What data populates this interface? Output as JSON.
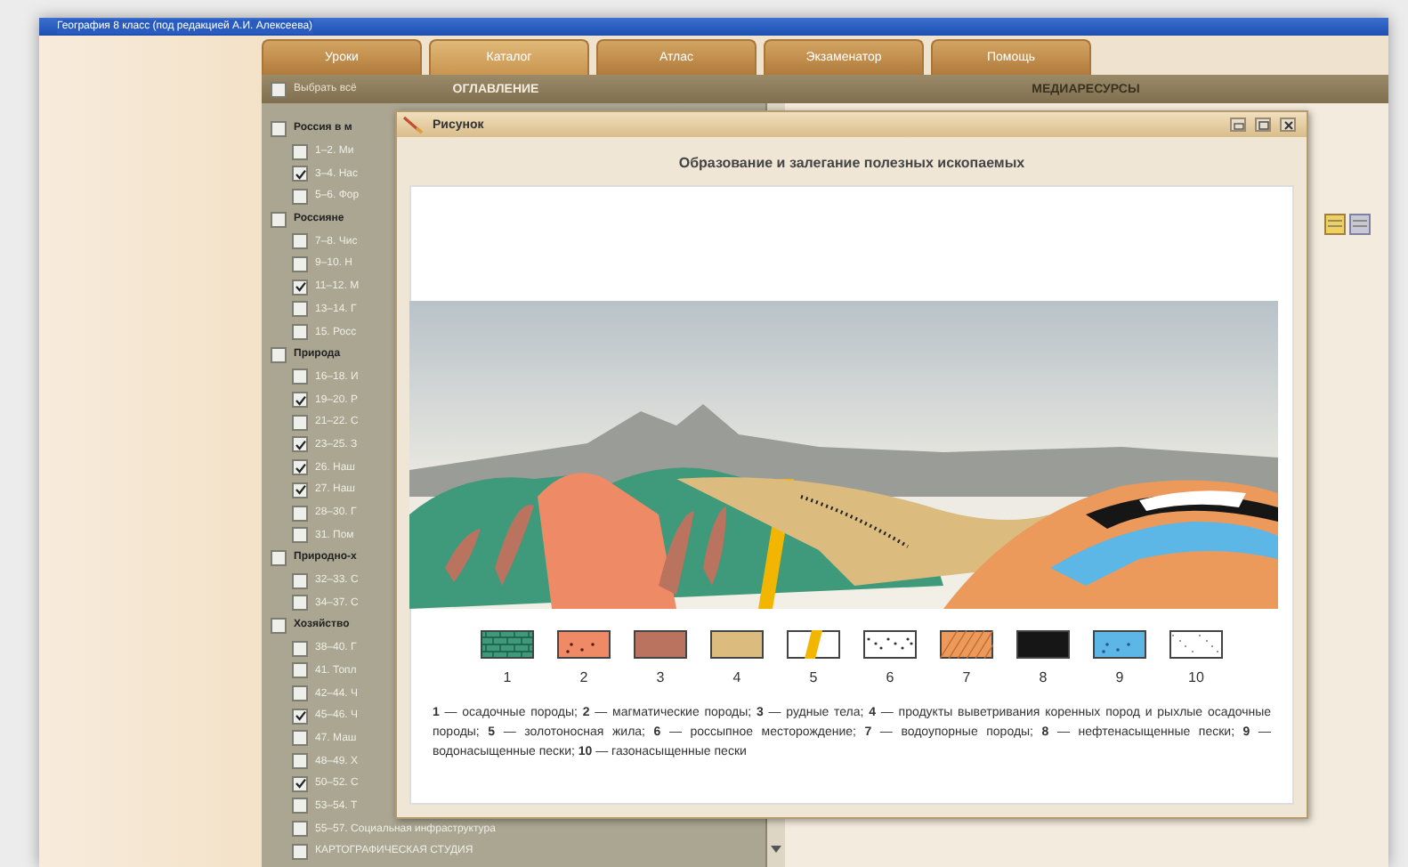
{
  "window": {
    "title": "География 8 класс (под редакцией А.И. Алексеева)"
  },
  "tabs": [
    {
      "label": "Уроки",
      "selected": false
    },
    {
      "label": "Каталог",
      "selected": true
    },
    {
      "label": "Атлас",
      "selected": false
    },
    {
      "label": "Экзаменатор",
      "selected": false
    },
    {
      "label": "Помощь",
      "selected": false
    }
  ],
  "toc": {
    "select_all": {
      "label": "Выбрать всё",
      "checked": false
    },
    "heading": "ОГЛАВЛЕНИЕ",
    "groups": [
      {
        "label": "Россия в м",
        "checked": false,
        "children": [
          {
            "label": "1–2. Ми",
            "checked": false
          },
          {
            "label": "3–4. Нас",
            "checked": true
          },
          {
            "label": "5–6. Фор",
            "checked": false
          }
        ]
      },
      {
        "label": "Россияне",
        "checked": false,
        "children": [
          {
            "label": "7–8. Чис",
            "checked": false
          },
          {
            "label": "9–10. Н",
            "checked": false
          },
          {
            "label": "11–12. М",
            "checked": true
          },
          {
            "label": "13–14. Г",
            "checked": false
          },
          {
            "label": "15. Росс",
            "checked": false
          }
        ]
      },
      {
        "label": "Природа",
        "checked": false,
        "children": [
          {
            "label": "16–18. И",
            "checked": false
          },
          {
            "label": "19–20. Р",
            "checked": true
          },
          {
            "label": "21–22. С",
            "checked": false
          },
          {
            "label": "23–25. З",
            "checked": true
          },
          {
            "label": "26. Наш",
            "checked": true
          },
          {
            "label": "27. Наш",
            "checked": true
          },
          {
            "label": "28–30. Г",
            "checked": false
          },
          {
            "label": "31. Пом",
            "checked": false
          }
        ]
      },
      {
        "label": "Природно-х",
        "checked": false,
        "children": [
          {
            "label": "32–33. С",
            "checked": false
          },
          {
            "label": "34–37. С",
            "checked": false
          }
        ]
      },
      {
        "label": "Хозяйство",
        "checked": false,
        "children": [
          {
            "label": "38–40. Г",
            "checked": false
          },
          {
            "label": "41. Топл",
            "checked": false
          },
          {
            "label": "42–44. Ч",
            "checked": false
          },
          {
            "label": "45–46. Ч",
            "checked": true
          },
          {
            "label": "47. Маш",
            "checked": false
          },
          {
            "label": "48–49. Х",
            "checked": false
          },
          {
            "label": "50–52. С",
            "checked": true
          },
          {
            "label": "53–54. Т",
            "checked": false
          },
          {
            "label": "55–57. Социальная инфраструктура",
            "checked": false
          }
        ]
      }
    ],
    "footer_item": {
      "label": "КАРТОГРАФИЧЕСКАЯ СТУДИЯ",
      "checked": false
    }
  },
  "media": {
    "heading": "МЕДИАРЕСУРСЫ"
  },
  "dialog": {
    "title": "Рисунок",
    "heading": "Образование и залегание полезных ископаемых",
    "legend": [
      {
        "number": "1",
        "kind": "brick",
        "color": "#3f9a7c"
      },
      {
        "number": "2",
        "kind": "dots",
        "color": "#ef8a66"
      },
      {
        "number": "3",
        "kind": "solid",
        "color": "#b9735e"
      },
      {
        "number": "4",
        "kind": "solid",
        "color": "#dcbc7e"
      },
      {
        "number": "5",
        "kind": "vein"
      },
      {
        "number": "6",
        "kind": "scatter"
      },
      {
        "number": "7",
        "kind": "hatch",
        "color": "#ec9a5c"
      },
      {
        "number": "8",
        "kind": "solid",
        "color": "#161616"
      },
      {
        "number": "9",
        "kind": "dots",
        "color": "#5cb6e6"
      },
      {
        "number": "10",
        "kind": "specks"
      }
    ],
    "caption": "**1** — осадочные породы; **2** — магматические породы; **3** — рудные тела; **4** — продукты выветривания коренных пород и рыхлые осадочные породы; **5** — золотоносная жила; **6** — россыпное месторождение; **7** — водоупорные породы; **8** — нефтенасыщенные пески; **9** — водонасыщенные пески; **10** — газонасыщенные пески"
  }
}
